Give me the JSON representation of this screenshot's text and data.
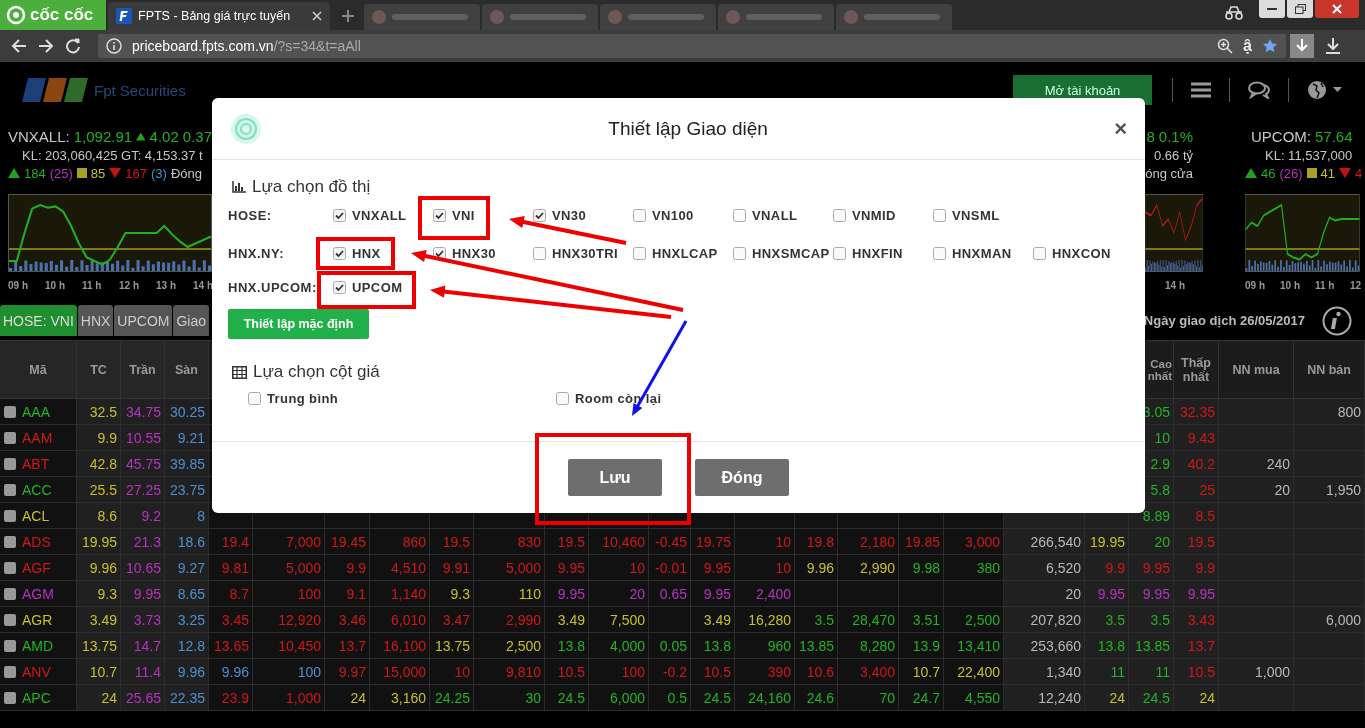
{
  "browser": {
    "brand": "cốc cốc",
    "tabs": [
      {
        "title": "FPTS - Bảng giá trực tuyến",
        "selected": true
      },
      {
        "selected": false
      },
      {
        "selected": false
      },
      {
        "selected": false
      },
      {
        "selected": false
      },
      {
        "selected": false
      }
    ],
    "address": {
      "host": "priceboard.fpts.com.vn",
      "path": "/?s=34&t=aAll"
    },
    "translate_glyph": "ậ"
  },
  "header": {
    "logo_text": "Fpt Securities",
    "open_account": "Mở tài khoản"
  },
  "indices": [
    {
      "kind": "full",
      "name": "VNXALL:",
      "value": "1,092.91",
      "change": "4.02",
      "percent": "0.37",
      "volume": "KL: 203,060,425 GT: 4,153.37 t",
      "up": "184",
      "ceil": "(25)",
      "ref": "85",
      "down": "167",
      "floor": "(3)",
      "status": "Đóng",
      "ticks": [
        "09 h",
        "10 h",
        "11 h",
        "12 h",
        "13 h",
        "14 h"
      ]
    },
    {
      "kind": "partial",
      "change": "8",
      "percent": "0.1%",
      "volume": "0.66 tỷ",
      "status": "óng cửa",
      "ticks": [
        "14 h"
      ]
    },
    {
      "kind": "full",
      "name": "UPCOM:",
      "value": "57.64",
      "volume": "KL: 11,537,000",
      "up": "46",
      "ceil": "(26)",
      "ref": "41",
      "down": "4",
      "ticks": [
        "09 h",
        "10 h",
        "11 h",
        "12"
      ]
    }
  ],
  "market_tabs": [
    {
      "label": "HOSE: VNI",
      "selected": true
    },
    {
      "label": "HNX",
      "selected": false
    },
    {
      "label": "UPCOM",
      "selected": false
    },
    {
      "label": "Giao",
      "selected": false
    }
  ],
  "trade_date": "Ngày giao dịch 26/05/2017",
  "table": {
    "columns": [
      "Mã",
      "TC",
      "Trần",
      "Sàn",
      "",
      "",
      "",
      "",
      "",
      "",
      "",
      "",
      "",
      "",
      "",
      "",
      "",
      "",
      "",
      "",
      "",
      "Cao nhất",
      "Thấp nhất",
      "NN mua",
      "NN bán"
    ],
    "rows": [
      {
        "checked": false,
        "cells": [
          {
            "value": "AAA",
            "color": "#22b422"
          },
          {
            "value": "32.5",
            "color": "#c8c02a"
          },
          {
            "value": "34.75",
            "color": "#b533c0"
          },
          {
            "value": "30.25",
            "color": "#4a90d0"
          },
          "",
          "",
          "",
          "",
          "",
          "",
          "",
          "",
          "",
          "",
          "",
          "",
          "",
          "",
          "",
          "",
          "",
          {
            "value": "3.05",
            "color": "#22b422"
          },
          {
            "value": "32.35",
            "color": "#d01818"
          },
          "",
          {
            "value": "800",
            "color": "#b8b8b8"
          }
        ]
      },
      {
        "checked": false,
        "cells": [
          {
            "value": "AAM",
            "color": "#d01818"
          },
          {
            "value": "9.9",
            "color": "#c8c02a"
          },
          {
            "value": "10.55",
            "color": "#b533c0"
          },
          {
            "value": "9.21",
            "color": "#4a90d0"
          },
          "",
          "",
          "",
          "",
          "",
          "",
          "",
          "",
          "",
          "",
          "",
          "",
          "",
          "",
          "",
          "",
          "",
          {
            "value": "10",
            "color": "#22b422"
          },
          {
            "value": "9.43",
            "color": "#d01818"
          },
          "",
          ""
        ]
      },
      {
        "checked": false,
        "cells": [
          {
            "value": "ABT",
            "color": "#d01818"
          },
          {
            "value": "42.8",
            "color": "#c8c02a"
          },
          {
            "value": "45.75",
            "color": "#b533c0"
          },
          {
            "value": "39.85",
            "color": "#4a90d0"
          },
          "",
          "",
          "",
          "",
          "",
          "",
          "",
          "",
          "",
          "",
          "",
          "",
          "",
          "",
          "",
          "",
          "",
          {
            "value": "2.9",
            "color": "#22b422"
          },
          {
            "value": "40.2",
            "color": "#d01818"
          },
          {
            "value": "240",
            "color": "#b8b8b8"
          },
          ""
        ]
      },
      {
        "checked": false,
        "cells": [
          {
            "value": "ACC",
            "color": "#22b422"
          },
          {
            "value": "25.5",
            "color": "#c8c02a"
          },
          {
            "value": "27.25",
            "color": "#b533c0"
          },
          {
            "value": "23.75",
            "color": "#4a90d0"
          },
          "",
          "",
          "",
          "",
          "",
          "",
          "",
          "",
          "",
          "",
          "",
          "",
          "",
          "",
          "",
          "",
          "",
          {
            "value": "5.8",
            "color": "#22b422"
          },
          {
            "value": "25",
            "color": "#d01818"
          },
          {
            "value": "20",
            "color": "#b8b8b8"
          },
          {
            "value": "1,950",
            "color": "#b8b8b8"
          }
        ]
      },
      {
        "checked": false,
        "cells": [
          {
            "value": "ACL",
            "color": "#c8c02a"
          },
          {
            "value": "8.6",
            "color": "#c8c02a"
          },
          {
            "value": "9.2",
            "color": "#b533c0"
          },
          {
            "value": "8",
            "color": "#4a90d0"
          },
          "",
          "",
          "",
          "",
          "",
          "",
          "",
          "",
          "",
          "",
          "",
          "",
          "",
          "",
          "",
          "",
          "",
          {
            "value": "8.89",
            "color": "#22b422"
          },
          {
            "value": "8.5",
            "color": "#d01818"
          },
          "",
          ""
        ]
      },
      {
        "checked": false,
        "cells": [
          {
            "value": "ADS",
            "color": "#d01818"
          },
          {
            "value": "19.95",
            "color": "#c8c02a"
          },
          {
            "value": "21.3",
            "color": "#b533c0"
          },
          {
            "value": "18.6",
            "color": "#4a90d0"
          },
          {
            "value": "19.4",
            "color": "#d01818"
          },
          {
            "value": "7,000",
            "color": "#d01818"
          },
          {
            "value": "19.45",
            "color": "#d01818"
          },
          {
            "value": "860",
            "color": "#d01818"
          },
          {
            "value": "19.5",
            "color": "#d01818"
          },
          {
            "value": "830",
            "color": "#d01818"
          },
          {
            "value": "19.5",
            "color": "#d01818"
          },
          {
            "value": "10,460",
            "color": "#d01818"
          },
          {
            "value": "-0.45",
            "color": "#d01818"
          },
          {
            "value": "19.75",
            "color": "#d01818"
          },
          {
            "value": "10",
            "color": "#d01818"
          },
          {
            "value": "19.8",
            "color": "#d01818"
          },
          {
            "value": "2,180",
            "color": "#d01818"
          },
          {
            "value": "19.85",
            "color": "#d01818"
          },
          {
            "value": "3,000",
            "color": "#d01818"
          },
          {
            "value": "266,540",
            "color": "#b8b8b8"
          },
          {
            "value": "19.95",
            "color": "#c8c02a"
          },
          {
            "value": "20",
            "color": "#22b422"
          },
          {
            "value": "19.5",
            "color": "#d01818"
          },
          "",
          ""
        ]
      },
      {
        "checked": false,
        "cells": [
          {
            "value": "AGF",
            "color": "#d01818"
          },
          {
            "value": "9.96",
            "color": "#c8c02a"
          },
          {
            "value": "10.65",
            "color": "#b533c0"
          },
          {
            "value": "9.27",
            "color": "#4a90d0"
          },
          {
            "value": "9.81",
            "color": "#d01818"
          },
          {
            "value": "5,000",
            "color": "#d01818"
          },
          {
            "value": "9.9",
            "color": "#d01818"
          },
          {
            "value": "4,510",
            "color": "#d01818"
          },
          {
            "value": "9.91",
            "color": "#d01818"
          },
          {
            "value": "5,000",
            "color": "#d01818"
          },
          {
            "value": "9.95",
            "color": "#d01818"
          },
          {
            "value": "10",
            "color": "#d01818"
          },
          {
            "value": "-0.01",
            "color": "#d01818"
          },
          {
            "value": "9.95",
            "color": "#d01818"
          },
          {
            "value": "10",
            "color": "#d01818"
          },
          {
            "value": "9.96",
            "color": "#c8c02a"
          },
          {
            "value": "2,990",
            "color": "#c8c02a"
          },
          {
            "value": "9.98",
            "color": "#22b422"
          },
          {
            "value": "380",
            "color": "#22b422"
          },
          {
            "value": "6,520",
            "color": "#b8b8b8"
          },
          {
            "value": "9.9",
            "color": "#d01818"
          },
          {
            "value": "9.95",
            "color": "#d01818"
          },
          {
            "value": "9.9",
            "color": "#d01818"
          },
          "",
          ""
        ]
      },
      {
        "checked": false,
        "cells": [
          {
            "value": "AGM",
            "color": "#b533c0"
          },
          {
            "value": "9.3",
            "color": "#c8c02a"
          },
          {
            "value": "9.95",
            "color": "#b533c0"
          },
          {
            "value": "8.65",
            "color": "#4a90d0"
          },
          {
            "value": "8.7",
            "color": "#d01818"
          },
          {
            "value": "100",
            "color": "#d01818"
          },
          {
            "value": "9.1",
            "color": "#d01818"
          },
          {
            "value": "1,140",
            "color": "#d01818"
          },
          {
            "value": "9.3",
            "color": "#c8c02a"
          },
          {
            "value": "110",
            "color": "#c8c02a"
          },
          {
            "value": "9.95",
            "color": "#b533c0"
          },
          {
            "value": "20",
            "color": "#b533c0"
          },
          {
            "value": "0.65",
            "color": "#b533c0"
          },
          {
            "value": "9.95",
            "color": "#b533c0"
          },
          {
            "value": "2,400",
            "color": "#b533c0"
          },
          "",
          "",
          "",
          "",
          {
            "value": "20",
            "color": "#b8b8b8"
          },
          {
            "value": "9.95",
            "color": "#b533c0"
          },
          {
            "value": "9.95",
            "color": "#b533c0"
          },
          {
            "value": "9.95",
            "color": "#b533c0"
          },
          "",
          ""
        ]
      },
      {
        "checked": false,
        "cells": [
          {
            "value": "AGR",
            "color": "#c8c02a"
          },
          {
            "value": "3.49",
            "color": "#c8c02a"
          },
          {
            "value": "3.73",
            "color": "#b533c0"
          },
          {
            "value": "3.25",
            "color": "#4a90d0"
          },
          {
            "value": "3.45",
            "color": "#d01818"
          },
          {
            "value": "12,920",
            "color": "#d01818"
          },
          {
            "value": "3.46",
            "color": "#d01818"
          },
          {
            "value": "6,010",
            "color": "#d01818"
          },
          {
            "value": "3.47",
            "color": "#d01818"
          },
          {
            "value": "2,990",
            "color": "#d01818"
          },
          {
            "value": "3.49",
            "color": "#c8c02a"
          },
          {
            "value": "7,500",
            "color": "#c8c02a"
          },
          "",
          {
            "value": "3.49",
            "color": "#c8c02a"
          },
          {
            "value": "16,280",
            "color": "#c8c02a"
          },
          {
            "value": "3.5",
            "color": "#22b422"
          },
          {
            "value": "28,470",
            "color": "#22b422"
          },
          {
            "value": "3.51",
            "color": "#22b422"
          },
          {
            "value": "2,500",
            "color": "#22b422"
          },
          {
            "value": "207,820",
            "color": "#b8b8b8"
          },
          {
            "value": "3.5",
            "color": "#22b422"
          },
          {
            "value": "3.5",
            "color": "#22b422"
          },
          {
            "value": "3.43",
            "color": "#d01818"
          },
          "",
          {
            "value": "6,000",
            "color": "#b8b8b8"
          }
        ]
      },
      {
        "checked": false,
        "cells": [
          {
            "value": "AMD",
            "color": "#22b422"
          },
          {
            "value": "13.75",
            "color": "#c8c02a"
          },
          {
            "value": "14.7",
            "color": "#b533c0"
          },
          {
            "value": "12.8",
            "color": "#4a90d0"
          },
          {
            "value": "13.65",
            "color": "#d01818"
          },
          {
            "value": "10,450",
            "color": "#d01818"
          },
          {
            "value": "13.7",
            "color": "#d01818"
          },
          {
            "value": "16,100",
            "color": "#d01818"
          },
          {
            "value": "13.75",
            "color": "#c8c02a"
          },
          {
            "value": "2,500",
            "color": "#c8c02a"
          },
          {
            "value": "13.8",
            "color": "#22b422"
          },
          {
            "value": "4,000",
            "color": "#22b422"
          },
          {
            "value": "0.05",
            "color": "#22b422"
          },
          {
            "value": "13.8",
            "color": "#22b422"
          },
          {
            "value": "960",
            "color": "#22b422"
          },
          {
            "value": "13.85",
            "color": "#22b422"
          },
          {
            "value": "8,280",
            "color": "#22b422"
          },
          {
            "value": "13.9",
            "color": "#22b422"
          },
          {
            "value": "13,410",
            "color": "#22b422"
          },
          {
            "value": "253,660",
            "color": "#b8b8b8"
          },
          {
            "value": "13.8",
            "color": "#22b422"
          },
          {
            "value": "13.85",
            "color": "#22b422"
          },
          {
            "value": "13.7",
            "color": "#d01818"
          },
          "",
          ""
        ]
      },
      {
        "checked": false,
        "cells": [
          {
            "value": "ANV",
            "color": "#d01818"
          },
          {
            "value": "10.7",
            "color": "#c8c02a"
          },
          {
            "value": "11.4",
            "color": "#b533c0"
          },
          {
            "value": "9.96",
            "color": "#4a90d0"
          },
          {
            "value": "9.96",
            "color": "#4a90d0"
          },
          {
            "value": "100",
            "color": "#4a90d0"
          },
          {
            "value": "9.97",
            "color": "#d01818"
          },
          {
            "value": "15,000",
            "color": "#d01818"
          },
          {
            "value": "10",
            "color": "#d01818"
          },
          {
            "value": "9,810",
            "color": "#d01818"
          },
          {
            "value": "10.5",
            "color": "#d01818"
          },
          {
            "value": "100",
            "color": "#d01818"
          },
          {
            "value": "-0.2",
            "color": "#d01818"
          },
          {
            "value": "10.5",
            "color": "#d01818"
          },
          {
            "value": "390",
            "color": "#d01818"
          },
          {
            "value": "10.6",
            "color": "#d01818"
          },
          {
            "value": "3,400",
            "color": "#d01818"
          },
          {
            "value": "10.7",
            "color": "#c8c02a"
          },
          {
            "value": "22,400",
            "color": "#c8c02a"
          },
          {
            "value": "1,340",
            "color": "#b8b8b8"
          },
          {
            "value": "11",
            "color": "#22b422"
          },
          {
            "value": "11",
            "color": "#22b422"
          },
          {
            "value": "10.5",
            "color": "#d01818"
          },
          {
            "value": "1,000",
            "color": "#b8b8b8"
          },
          ""
        ]
      },
      {
        "checked": false,
        "cells": [
          {
            "value": "APC",
            "color": "#22b422"
          },
          {
            "value": "24",
            "color": "#c8c02a"
          },
          {
            "value": "25.65",
            "color": "#b533c0"
          },
          {
            "value": "22.35",
            "color": "#4a90d0"
          },
          {
            "value": "23.9",
            "color": "#d01818"
          },
          {
            "value": "1,000",
            "color": "#d01818"
          },
          {
            "value": "24",
            "color": "#c8c02a"
          },
          {
            "value": "3,160",
            "color": "#c8c02a"
          },
          {
            "value": "24.25",
            "color": "#22b422"
          },
          {
            "value": "30",
            "color": "#22b422"
          },
          {
            "value": "24.5",
            "color": "#22b422"
          },
          {
            "value": "6,000",
            "color": "#22b422"
          },
          {
            "value": "0.5",
            "color": "#22b422"
          },
          {
            "value": "24.5",
            "color": "#22b422"
          },
          {
            "value": "24,160",
            "color": "#22b422"
          },
          {
            "value": "24.6",
            "color": "#22b422"
          },
          {
            "value": "70",
            "color": "#22b422"
          },
          {
            "value": "24.7",
            "color": "#22b422"
          },
          {
            "value": "4,550",
            "color": "#22b422"
          },
          {
            "value": "12,240",
            "color": "#b8b8b8"
          },
          {
            "value": "24",
            "color": "#c8c02a"
          },
          {
            "value": "24.5",
            "color": "#22b422"
          },
          {
            "value": "24",
            "color": "#c8c02a"
          },
          "",
          ""
        ]
      }
    ]
  },
  "dialog": {
    "title": "Thiết lập Giao diện",
    "close": "×",
    "chart_section": {
      "title": "Lựa chọn đồ thị",
      "groups": [
        {
          "label": "HOSE:",
          "options": [
            {
              "label": "VNXALL",
              "checked": true
            },
            {
              "label": "VNI",
              "checked": true
            },
            {
              "label": "VN30",
              "checked": true
            },
            {
              "label": "VN100",
              "checked": false
            },
            {
              "label": "VNALL",
              "checked": false
            },
            {
              "label": "VNMID",
              "checked": false
            },
            {
              "label": "VNSML",
              "checked": false
            }
          ]
        },
        {
          "label": "HNX.NY:",
          "options": [
            {
              "label": "HNX",
              "checked": true
            },
            {
              "label": "HNX30",
              "checked": true
            },
            {
              "label": "HNX30TRI",
              "checked": false
            },
            {
              "label": "HNXLCAP",
              "checked": false
            },
            {
              "label": "HNXSMCAP",
              "checked": false
            },
            {
              "label": "HNXFIN",
              "checked": false
            },
            {
              "label": "HNXMAN",
              "checked": false
            },
            {
              "label": "HNXCON",
              "checked": false
            }
          ]
        },
        {
          "label": "HNX.UPCOM:",
          "options": [
            {
              "label": "UPCOM",
              "checked": true
            }
          ]
        }
      ],
      "reset_button": "Thiết lập mặc định"
    },
    "column_section": {
      "title": "Lựa chọn cột giá",
      "options": [
        {
          "label": "Trung bình",
          "checked": false
        },
        {
          "label": "Room còn lại",
          "checked": false
        }
      ]
    },
    "buttons": [
      "Lưu",
      "Đóng"
    ]
  }
}
